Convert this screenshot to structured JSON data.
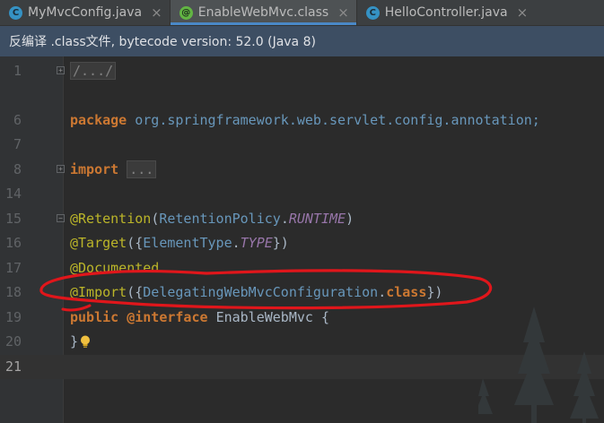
{
  "tabs": [
    {
      "label": "MyMvcConfig.java",
      "icon": "class-icon",
      "active": false
    },
    {
      "label": "EnableWebMvc.class",
      "icon": "annotation-icon",
      "active": true
    },
    {
      "label": "HelloController.java",
      "icon": "class-icon",
      "active": false
    }
  ],
  "infobar": {
    "text": "反编译 .class文件, bytecode version: 52.0 (Java 8)"
  },
  "editor": {
    "lines": [
      {
        "num": "1",
        "text": "/.../"
      },
      {
        "num": "6",
        "kw": "package",
        "rest": "org.springframework.web.servlet.config.annotation;"
      },
      {
        "num": "7",
        "text": ""
      },
      {
        "num": "8",
        "kw": "import",
        "rest": "..."
      },
      {
        "num": "14",
        "text": ""
      },
      {
        "num": "15",
        "ann": "@Retention",
        "p1": "(",
        "a": "RetentionPolicy",
        "dot": ".",
        "c": "RUNTIME",
        "p2": ")"
      },
      {
        "num": "16",
        "ann": "@Target",
        "p1": "({",
        "a": "ElementType",
        "dot": ".",
        "c": "TYPE",
        "p2": "})"
      },
      {
        "num": "17",
        "ann": "@Documented"
      },
      {
        "num": "18",
        "ann": "@Import",
        "p1": "({",
        "a": "DelegatingWebMvcConfiguration",
        "dot": ".",
        "c": "class",
        "p2": "})"
      },
      {
        "num": "19",
        "kw": "public",
        "mid": "@interface",
        "rest": "EnableWebMvc {"
      },
      {
        "num": "20",
        "text": "}"
      },
      {
        "num": "21",
        "text": ""
      }
    ]
  },
  "colors": {
    "keyword": "#cc7832",
    "annotation": "#bbb529",
    "package": "#6897bb",
    "constant": "#9876aa",
    "highlight": "#e0161b"
  }
}
